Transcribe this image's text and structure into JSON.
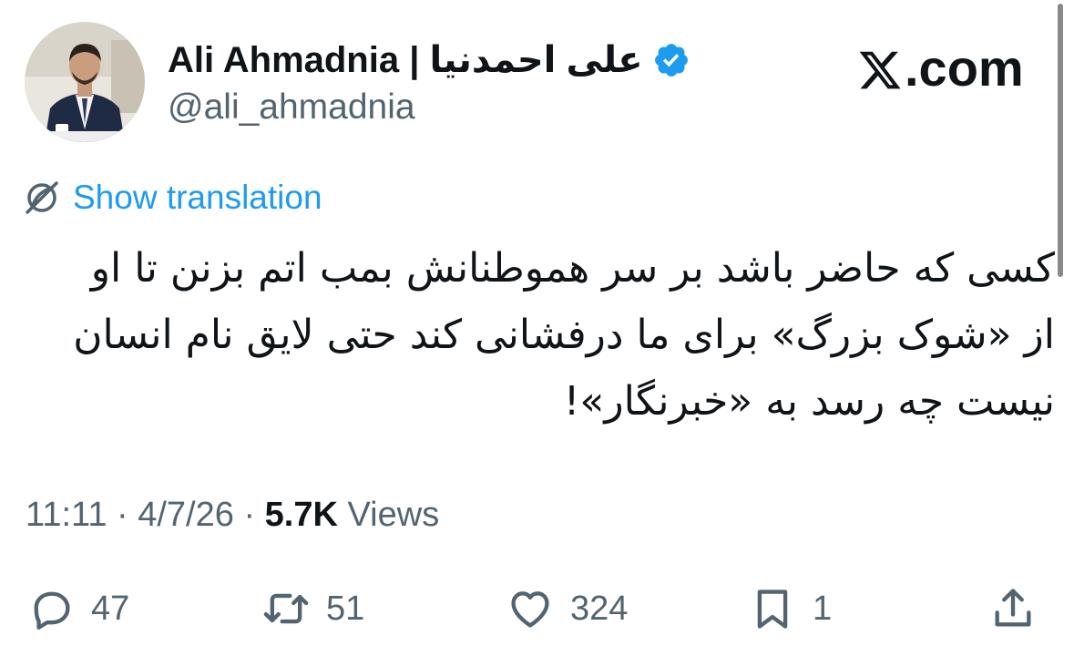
{
  "author": {
    "display_name": "Ali Ahmadnia | علی احمدنیا",
    "handle": "@ali_ahmadnia",
    "verified_icon": "verified-badge-icon",
    "avatar_icon": "avatar"
  },
  "brand": {
    "label": ".com",
    "icon": "x-logo-icon"
  },
  "translation": {
    "label": "Show translation",
    "icon": "globe-translate-icon"
  },
  "tweet": {
    "lines": [
      "کسی که حاضر باشد بر سر هموطنانش بمب اتم بزنن تا او",
      "از «شوک بزرگ» برای ما درفشانی کند حتی لایق نام انسان",
      "نیست چه رسد به «خبرنگار»!"
    ]
  },
  "meta": {
    "time": "11:11",
    "date": "4/7/26",
    "views_count": "5.7K",
    "views_label": "Views",
    "separator": "·"
  },
  "actions": {
    "replies": "47",
    "reposts": "51",
    "likes": "324",
    "bookmarks": "1"
  },
  "colors": {
    "accent": "#1d9bf0",
    "text": "#0f1419",
    "muted": "#536471"
  }
}
